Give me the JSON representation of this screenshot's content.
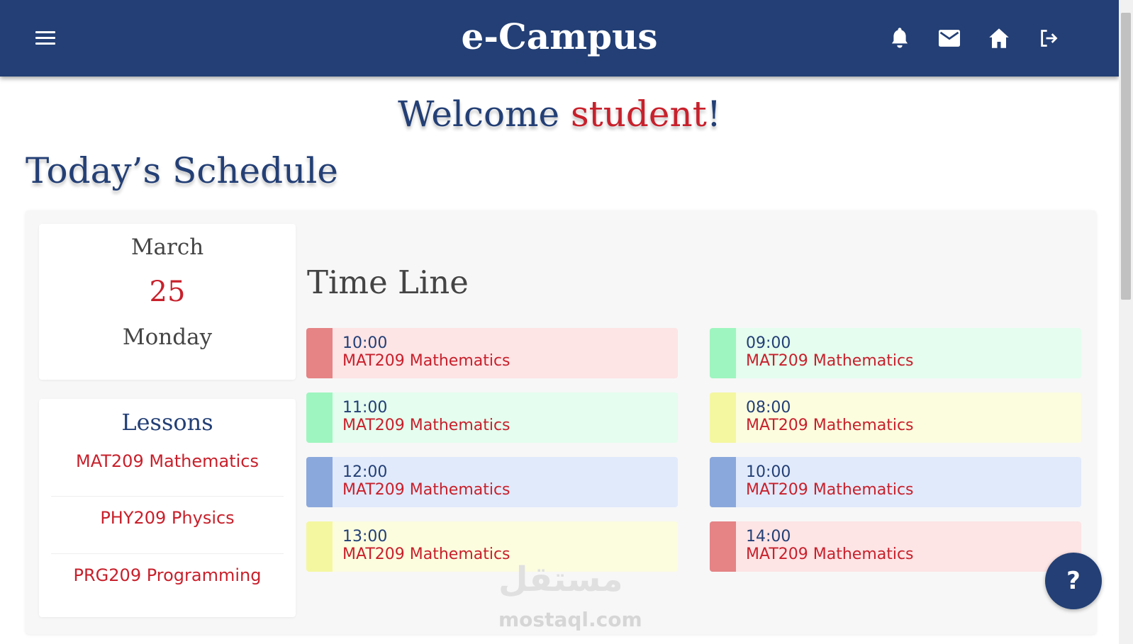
{
  "header": {
    "brand": "e-Campus",
    "icons": [
      "menu-icon",
      "bell-icon",
      "mail-icon",
      "home-icon",
      "logout-icon"
    ],
    "color": "#233f75"
  },
  "welcome": {
    "prefix": "Welcome ",
    "name": "student",
    "suffix": "!"
  },
  "schedule_title": "Today’s Schedule",
  "date": {
    "month": "March",
    "day": "25",
    "weekday": "Monday"
  },
  "lessons": {
    "title": "Lessons",
    "items": [
      "MAT209 Mathematics",
      "PHY209 Physics",
      "PRG209 Programming"
    ]
  },
  "timeline": {
    "title": "Time Line",
    "items": [
      {
        "time": "10:00",
        "subject": "MAT209 Mathematics",
        "color": "red"
      },
      {
        "time": "09:00",
        "subject": "MAT209 Mathematics",
        "color": "green"
      },
      {
        "time": "11:00",
        "subject": "MAT209 Mathematics",
        "color": "green"
      },
      {
        "time": "08:00",
        "subject": "MAT209 Mathematics",
        "color": "yellow"
      },
      {
        "time": "12:00",
        "subject": "MAT209 Mathematics",
        "color": "blue"
      },
      {
        "time": "10:00",
        "subject": "MAT209 Mathematics",
        "color": "blue"
      },
      {
        "time": "13:00",
        "subject": "MAT209 Mathematics",
        "color": "yellow"
      },
      {
        "time": "14:00",
        "subject": "MAT209 Mathematics",
        "color": "red"
      }
    ]
  },
  "help": {
    "label": "?"
  },
  "watermark": {
    "arabic": "مستقل",
    "latin": "mostaql.com"
  }
}
